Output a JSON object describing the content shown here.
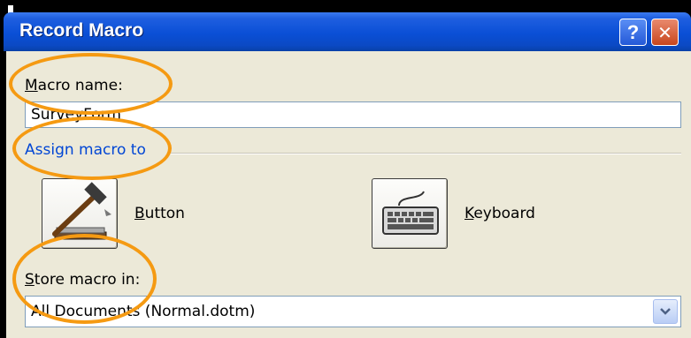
{
  "window": {
    "title": "Record Macro"
  },
  "title_buttons": {
    "help_glyph": "?",
    "close_glyph": "✕"
  },
  "macro_name": {
    "label_first": "M",
    "label_rest": "acro name:",
    "value": "SurveyForm"
  },
  "assign": {
    "section_title": "Assign macro to",
    "button_label_first": "B",
    "button_label_rest": "utton",
    "keyboard_label_first": "K",
    "keyboard_label_rest": "eyboard"
  },
  "store": {
    "label_first": "S",
    "label_rest": "tore macro in:",
    "value": "All Documents (Normal.dotm)"
  },
  "icons": {
    "button_icon": "hammer-icon",
    "keyboard_icon": "keyboard-icon",
    "dropdown_icon": "chevron-down-icon"
  },
  "colors": {
    "titlebar": "#0a4fd6",
    "body": "#ece9d8",
    "section": "#0046d5",
    "highlight_oval": "#f59a12"
  }
}
